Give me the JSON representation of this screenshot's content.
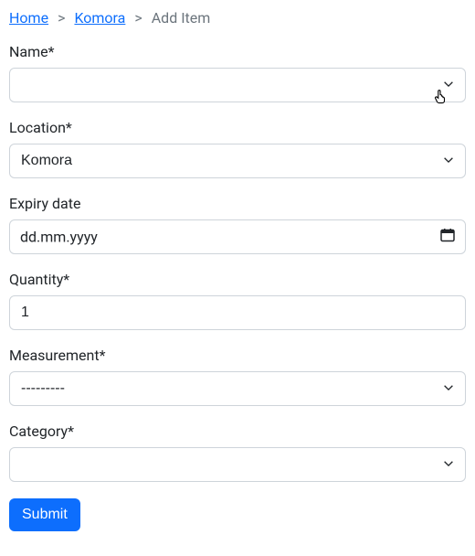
{
  "breadcrumb": {
    "home": "Home",
    "komora": "Komora",
    "current": "Add Item"
  },
  "form": {
    "name": {
      "label": "Name*",
      "value": ""
    },
    "location": {
      "label": "Location*",
      "value": "Komora"
    },
    "expiry": {
      "label": "Expiry date",
      "placeholder": "dd.mm.yyyy"
    },
    "quantity": {
      "label": "Quantity*",
      "value": "1"
    },
    "measurement": {
      "label": "Measurement*",
      "value": "---------"
    },
    "category": {
      "label": "Category*",
      "value": ""
    },
    "submit": "Submit"
  }
}
